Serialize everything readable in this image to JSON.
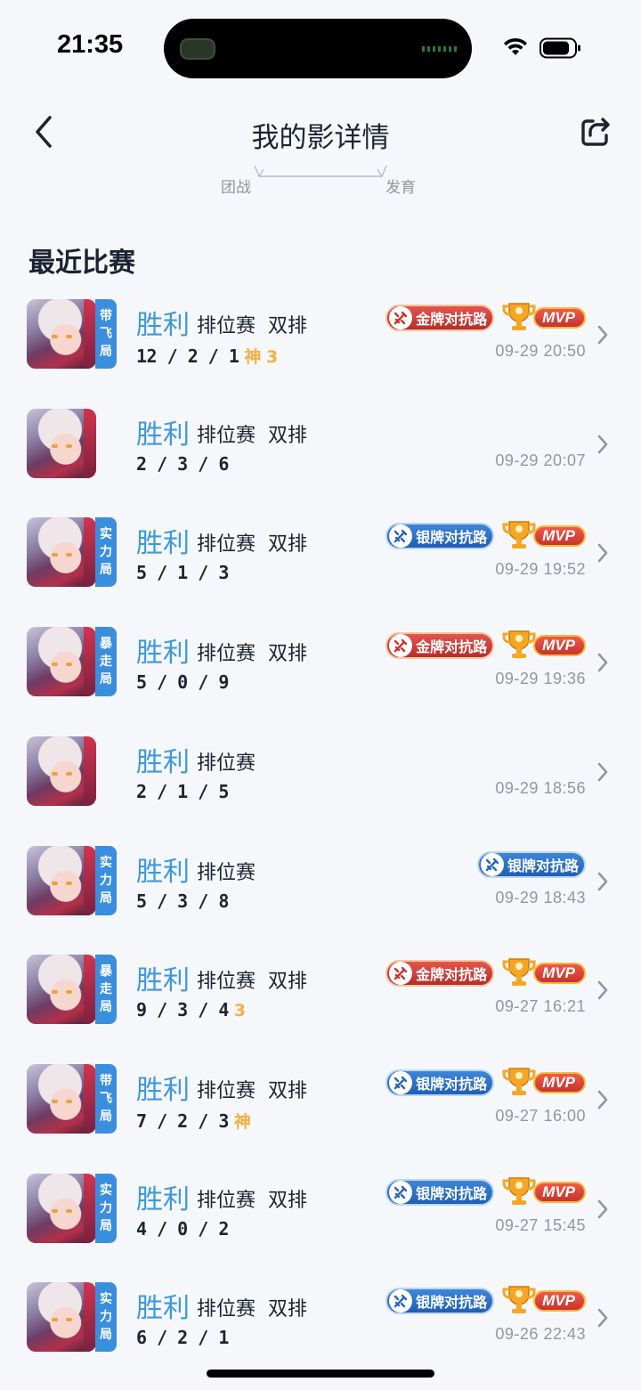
{
  "status_bar": {
    "time": "21:35"
  },
  "header": {
    "title": "我的影详情",
    "sub_tab_left": "团战",
    "sub_tab_right": "发育"
  },
  "section_title": "最近比赛",
  "matches": [
    {
      "tag": [
        "带",
        "飞",
        "局"
      ],
      "result": "胜利",
      "mode": "排位赛  双排",
      "kda": "12/2/1",
      "extra": "神 3",
      "lane": "金牌对抗路",
      "lane_tier": "gold",
      "mvp": "MVP",
      "time": "09-29 20:50"
    },
    {
      "tag": [],
      "result": "胜利",
      "mode": "排位赛  双排",
      "kda": "2/3/6",
      "extra": "",
      "lane": "",
      "lane_tier": "",
      "mvp": "",
      "time": "09-29 20:07"
    },
    {
      "tag": [
        "实",
        "力",
        "局"
      ],
      "result": "胜利",
      "mode": "排位赛  双排",
      "kda": "5/1/3",
      "extra": "",
      "lane": "银牌对抗路",
      "lane_tier": "silver",
      "mvp": "MVP",
      "time": "09-29 19:52"
    },
    {
      "tag": [
        "暴",
        "走",
        "局"
      ],
      "result": "胜利",
      "mode": "排位赛  双排",
      "kda": "5/0/9",
      "extra": "",
      "lane": "金牌对抗路",
      "lane_tier": "gold",
      "mvp": "MVP",
      "time": "09-29 19:36"
    },
    {
      "tag": [],
      "result": "胜利",
      "mode": "排位赛",
      "kda": "2/1/5",
      "extra": "",
      "lane": "",
      "lane_tier": "",
      "mvp": "",
      "time": "09-29 18:56"
    },
    {
      "tag": [
        "实",
        "力",
        "局"
      ],
      "result": "胜利",
      "mode": "排位赛",
      "kda": "5/3/8",
      "extra": "",
      "lane": "银牌对抗路",
      "lane_tier": "silver",
      "mvp": "",
      "time": "09-29 18:43"
    },
    {
      "tag": [
        "暴",
        "走",
        "局"
      ],
      "result": "胜利",
      "mode": "排位赛  双排",
      "kda": "9/3/4",
      "extra": "3",
      "lane": "金牌对抗路",
      "lane_tier": "gold",
      "mvp": "MVP",
      "time": "09-27 16:21"
    },
    {
      "tag": [
        "带",
        "飞",
        "局"
      ],
      "result": "胜利",
      "mode": "排位赛  双排",
      "kda": "7/2/3",
      "extra": "神",
      "lane": "银牌对抗路",
      "lane_tier": "silver",
      "mvp": "MVP",
      "time": "09-27 16:00"
    },
    {
      "tag": [
        "实",
        "力",
        "局"
      ],
      "result": "胜利",
      "mode": "排位赛  双排",
      "kda": "4/0/2",
      "extra": "",
      "lane": "银牌对抗路",
      "lane_tier": "silver",
      "mvp": "MVP",
      "time": "09-27 15:45"
    },
    {
      "tag": [
        "实",
        "力",
        "局"
      ],
      "result": "胜利",
      "mode": "排位赛  双排",
      "kda": "6/2/1",
      "extra": "",
      "lane": "银牌对抗路",
      "lane_tier": "silver",
      "mvp": "MVP",
      "time": "09-26 22:43"
    }
  ]
}
